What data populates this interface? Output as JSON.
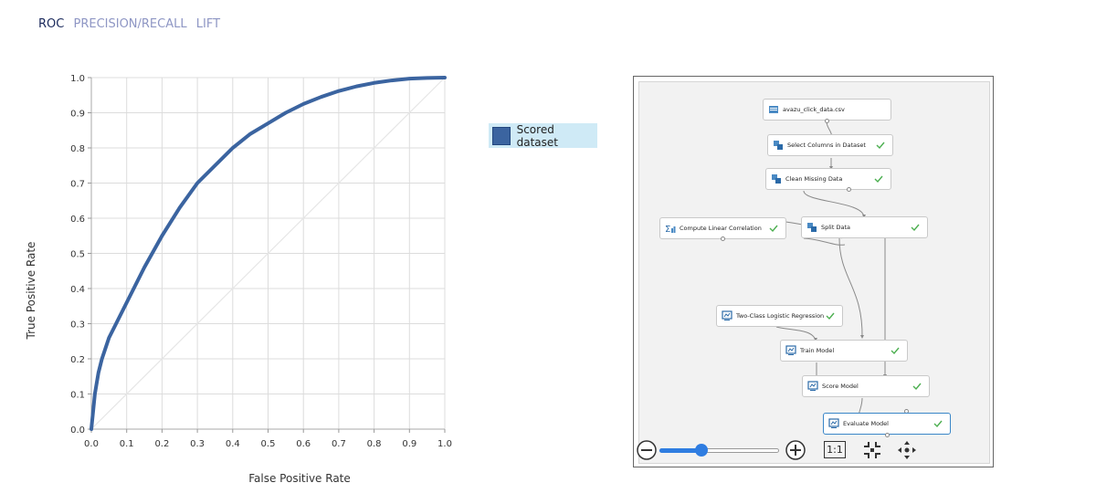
{
  "tabs": [
    {
      "label": "ROC",
      "active": true
    },
    {
      "label": "PRECISION/RECALL",
      "active": false
    },
    {
      "label": "LIFT",
      "active": false
    }
  ],
  "chart_data": {
    "type": "line",
    "xlabel": "False Positive Rate",
    "ylabel": "True Positive Rate",
    "xlim": [
      0,
      1
    ],
    "ylim": [
      0,
      1
    ],
    "xticks": [
      "0.0",
      "0.1",
      "0.2",
      "0.3",
      "0.4",
      "0.5",
      "0.6",
      "0.7",
      "0.8",
      "0.9",
      "1.0"
    ],
    "yticks": [
      "0.0",
      "0.1",
      "0.2",
      "0.3",
      "0.4",
      "0.5",
      "0.6",
      "0.7",
      "0.8",
      "0.9",
      "1.0"
    ],
    "grid": true,
    "series": [
      {
        "name": "Scored dataset",
        "color": "#3b64a0",
        "x": [
          0,
          0.01,
          0.02,
          0.03,
          0.05,
          0.07,
          0.1,
          0.15,
          0.2,
          0.25,
          0.3,
          0.35,
          0.4,
          0.45,
          0.5,
          0.55,
          0.6,
          0.65,
          0.7,
          0.75,
          0.8,
          0.85,
          0.9,
          0.95,
          1.0
        ],
        "y": [
          0,
          0.1,
          0.16,
          0.2,
          0.26,
          0.3,
          0.36,
          0.46,
          0.55,
          0.63,
          0.7,
          0.75,
          0.8,
          0.84,
          0.87,
          0.9,
          0.925,
          0.945,
          0.962,
          0.975,
          0.985,
          0.992,
          0.997,
          0.999,
          1.0
        ]
      },
      {
        "color": "#e6e6e6",
        "x": [
          0,
          1
        ],
        "y": [
          0,
          1
        ]
      }
    ]
  },
  "legend": {
    "label": "Scored dataset",
    "color": "#3b64a0"
  },
  "experiment": {
    "nodes": [
      {
        "id": "avazu",
        "label": "avazu_click_data.csv",
        "icon": "dataset-icon",
        "check": false
      },
      {
        "id": "select",
        "label": "Select Columns in Dataset",
        "icon": "module-icon",
        "check": true
      },
      {
        "id": "clean",
        "label": "Clean Missing Data",
        "icon": "module-icon",
        "check": true
      },
      {
        "id": "corr",
        "label": "Compute Linear Correlation",
        "icon": "statistics-icon",
        "check": true
      },
      {
        "id": "split",
        "label": "Split Data",
        "icon": "module-icon",
        "check": true
      },
      {
        "id": "logreg",
        "label": "Two-Class Logistic Regression",
        "icon": "model-icon",
        "check": true
      },
      {
        "id": "train",
        "label": "Train Model",
        "icon": "model-icon",
        "check": true
      },
      {
        "id": "score",
        "label": "Score Model",
        "icon": "model-icon",
        "check": true
      },
      {
        "id": "evaluate",
        "label": "Evaluate Model",
        "icon": "model-icon",
        "check": true,
        "selected": true
      }
    ]
  },
  "toolbar": {
    "zoom_out_icon": "minus-circle-icon",
    "zoom_in_icon": "plus-circle-icon",
    "zoom_fraction": 0.35,
    "actual_size_label": "1:1",
    "fit_icon": "fit-to-screen-icon",
    "pan_icon": "pan-arrows-icon"
  }
}
